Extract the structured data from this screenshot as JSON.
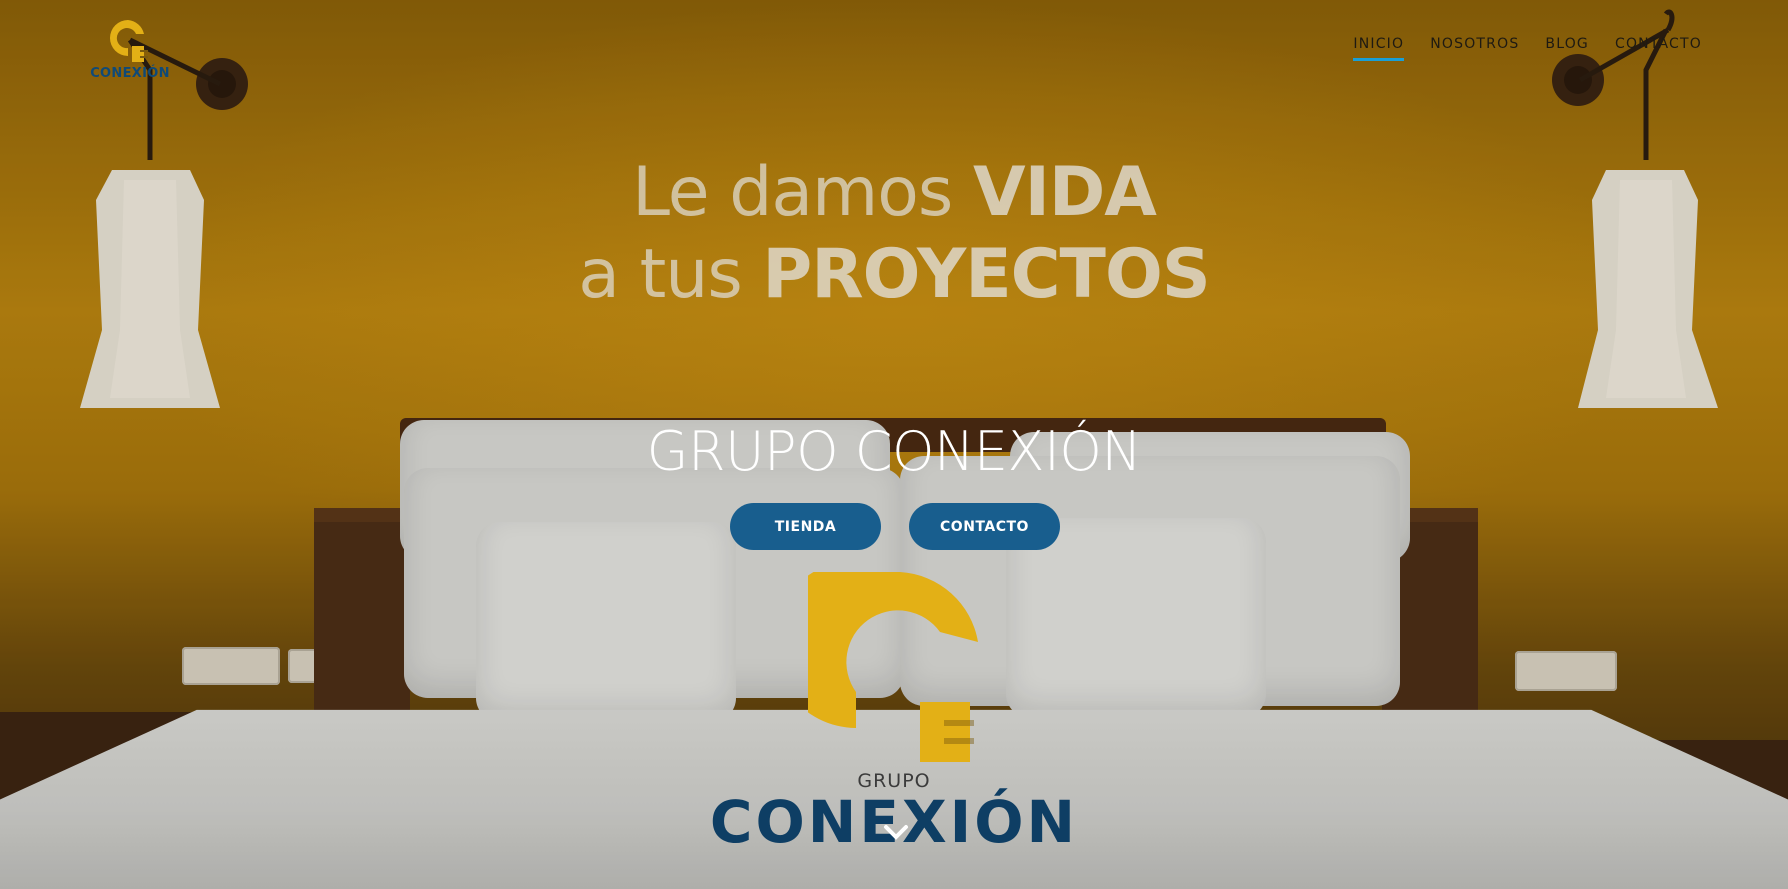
{
  "brand": {
    "logo_text": "CONEXIÓN",
    "big_logo_top": "GRUPO",
    "big_logo_bottom": "CONEXIÓN"
  },
  "nav": {
    "items": [
      {
        "label": "INICIO",
        "active": true
      },
      {
        "label": "NOSOTROS",
        "active": false
      },
      {
        "label": "BLOG",
        "active": false
      },
      {
        "label": "CONTACTO",
        "active": false
      }
    ]
  },
  "hero": {
    "line1_light": "Le damos ",
    "line1_bold": "VIDA",
    "line2_light": "a tus ",
    "line2_bold": "PROYECTOS",
    "title": "GRUPO CONEXIÓN",
    "buttons": {
      "store": "TIENDA",
      "contact": "CONTACTO"
    },
    "scroll_icon": "chevron-down-icon"
  },
  "colors": {
    "accent": "#1a9fd6",
    "button": "#185e8e",
    "logo_yellow": "#e3b016",
    "logo_blue": "#0e3e64"
  }
}
